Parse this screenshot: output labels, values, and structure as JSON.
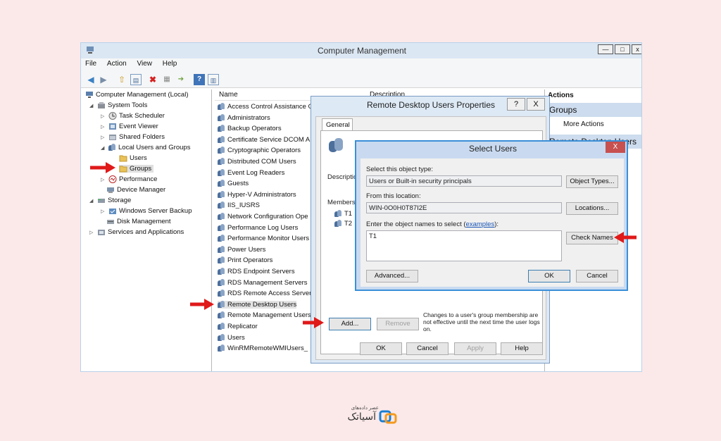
{
  "window": {
    "title": "Computer Management"
  },
  "menu": [
    "File",
    "Action",
    "View",
    "Help"
  ],
  "tree": {
    "root": "Computer Management (Local)",
    "system_tools": "System Tools",
    "task_scheduler": "Task Scheduler",
    "event_viewer": "Event Viewer",
    "shared_folders": "Shared Folders",
    "local_users_groups": "Local Users and Groups",
    "users": "Users",
    "groups": "Groups",
    "performance": "Performance",
    "device_manager": "Device Manager",
    "storage": "Storage",
    "windows_server_backup": "Windows Server Backup",
    "disk_management": "Disk Management",
    "services_apps": "Services and Applications"
  },
  "list": {
    "header_name": "Name",
    "header_description": "Description",
    "items": [
      "Access Control Assistance O",
      "Administrators",
      "Backup Operators",
      "Certificate Service DCOM A",
      "Cryptographic Operators",
      "Distributed COM Users",
      "Event Log Readers",
      "Guests",
      "Hyper-V Administrators",
      "IIS_IUSRS",
      "Network Configuration Ope",
      "Performance Log Users",
      "Performance Monitor Users",
      "Power Users",
      "Print Operators",
      "RDS Endpoint Servers",
      "RDS Management Servers",
      "RDS Remote Access Servers",
      "Remote Desktop Users",
      "Remote Management Users",
      "Replicator",
      "Users",
      "WinRMRemoteWMIUsers_"
    ]
  },
  "actions": {
    "title": "Actions",
    "group": "Groups",
    "more": "More Actions",
    "selected": "Remote Desktop Users"
  },
  "props": {
    "title": "Remote Desktop Users Properties",
    "help_btn": "?",
    "close_btn": "X",
    "tab_general": "General",
    "description_label": "Descriptio",
    "members_label": "Members:",
    "members": [
      "T1",
      "T2"
    ],
    "add": "Add...",
    "remove": "Remove",
    "note": "Changes to a user's group membership are not effective until the next time the user logs on.",
    "ok": "OK",
    "cancel": "Cancel",
    "apply": "Apply",
    "help": "Help"
  },
  "select_users": {
    "title": "Select Users",
    "close_btn": "X",
    "object_type_label": "Select this object type:",
    "object_type_value": "Users or Built-in security principals",
    "object_types_btn": "Object Types...",
    "location_label": "From this location:",
    "location_value": "WIN-0O0H0T87I2E",
    "locations_btn": "Locations...",
    "names_label": "Enter the object names to select (",
    "names_link": "examples",
    "names_label_end": "):",
    "names_value": "T1",
    "check_names_btn": "Check Names",
    "advanced_btn": "Advanced...",
    "ok": "OK",
    "cancel": "Cancel"
  },
  "logo": {
    "small_text": "عصر داده‌های",
    "large_text": "آسیاتک"
  },
  "colors": {
    "arrow": "#e01919",
    "background": "#fbe9e9"
  }
}
